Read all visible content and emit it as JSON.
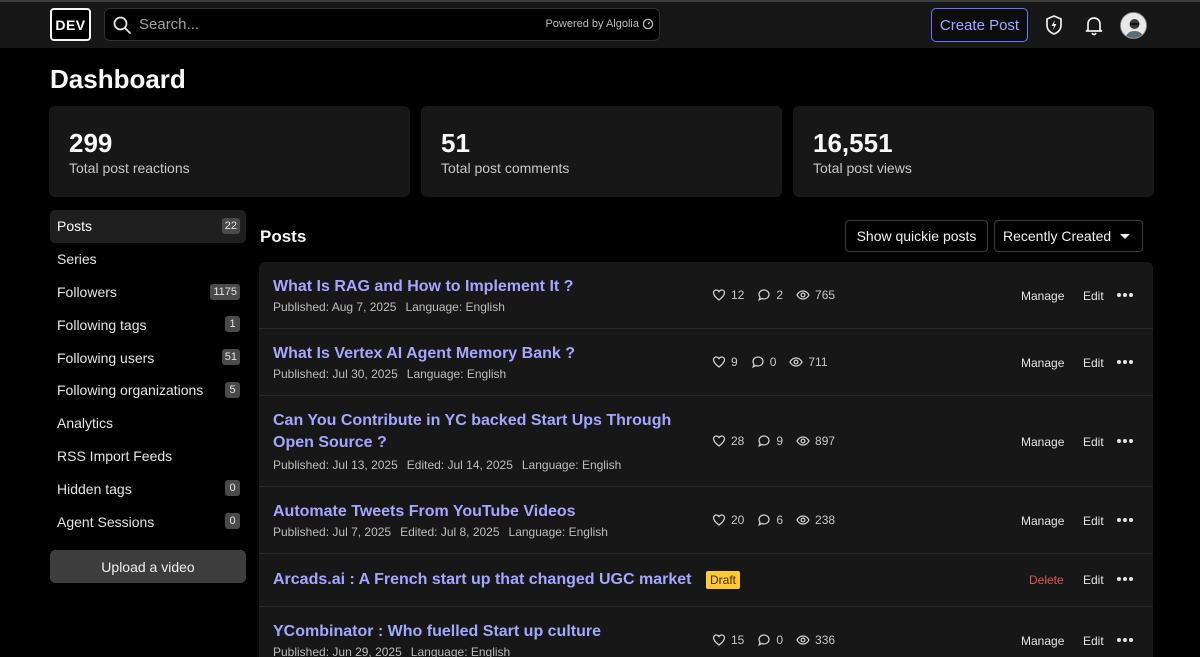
{
  "header": {
    "logo": "DEV",
    "search_placeholder": "Search...",
    "powered_by": "Powered by Algolia",
    "create_post": "Create Post"
  },
  "page_title": "Dashboard",
  "stats": [
    {
      "value": "299",
      "label": "Total post reactions"
    },
    {
      "value": "51",
      "label": "Total post comments"
    },
    {
      "value": "16,551",
      "label": "Total post views"
    }
  ],
  "sidebar": {
    "items": [
      {
        "label": "Posts",
        "count": "22",
        "active": true
      },
      {
        "label": "Series",
        "count": ""
      },
      {
        "label": "Followers",
        "count": "1175"
      },
      {
        "label": "Following tags",
        "count": "1"
      },
      {
        "label": "Following users",
        "count": "51"
      },
      {
        "label": "Following organizations",
        "count": "5"
      },
      {
        "label": "Analytics",
        "count": ""
      },
      {
        "label": "RSS Import Feeds",
        "count": ""
      },
      {
        "label": "Hidden tags",
        "count": "0"
      },
      {
        "label": "Agent Sessions",
        "count": "0"
      }
    ],
    "upload": "Upload a video"
  },
  "posts_header": {
    "title": "Posts",
    "quickie": "Show quickie posts",
    "sort": "Recently Created"
  },
  "labels": {
    "published": "Published:",
    "edited": "Edited:",
    "language": "Language:",
    "manage": "Manage",
    "edit": "Edit",
    "delete": "Delete",
    "draft": "Draft"
  },
  "posts": [
    {
      "title": "What Is RAG and How to Implement It ?",
      "published": "Aug 7, 2025",
      "edited": "",
      "language": "English",
      "reactions": "12",
      "comments": "2",
      "views": "765"
    },
    {
      "title": "What Is Vertex AI Agent Memory Bank ?",
      "published": "Jul 30, 2025",
      "edited": "",
      "language": "English",
      "reactions": "9",
      "comments": "0",
      "views": "711"
    },
    {
      "title": "Can You Contribute in YC backed Start Ups Through Open Source ?",
      "published": "Jul 13, 2025",
      "edited": "Jul 14, 2025",
      "language": "English",
      "reactions": "28",
      "comments": "9",
      "views": "897"
    },
    {
      "title": "Automate Tweets From YouTube Videos",
      "published": "Jul 7, 2025",
      "edited": "Jul 8, 2025",
      "language": "English",
      "reactions": "20",
      "comments": "6",
      "views": "238"
    },
    {
      "title": "Arcads.ai : A French start up that changed UGC market",
      "draft": true
    },
    {
      "title": "YCombinator : Who fuelled Start up culture",
      "published": "Jun 29, 2025",
      "edited": "",
      "language": "English",
      "reactions": "15",
      "comments": "0",
      "views": "336"
    }
  ],
  "colors": {
    "accent": "#a3a7ff",
    "button_border": "#6e73ff",
    "draft": "#ffc933",
    "delete": "#e0584f",
    "card_bg": "#171717"
  },
  "icons": {
    "search": "search-icon",
    "algolia": "algolia-icon",
    "shield": "shield-bolt-icon",
    "bell": "bell-icon",
    "heart": "heart-icon",
    "comment": "comment-icon",
    "eye": "eye-icon",
    "more": "more-horizontal-icon"
  }
}
